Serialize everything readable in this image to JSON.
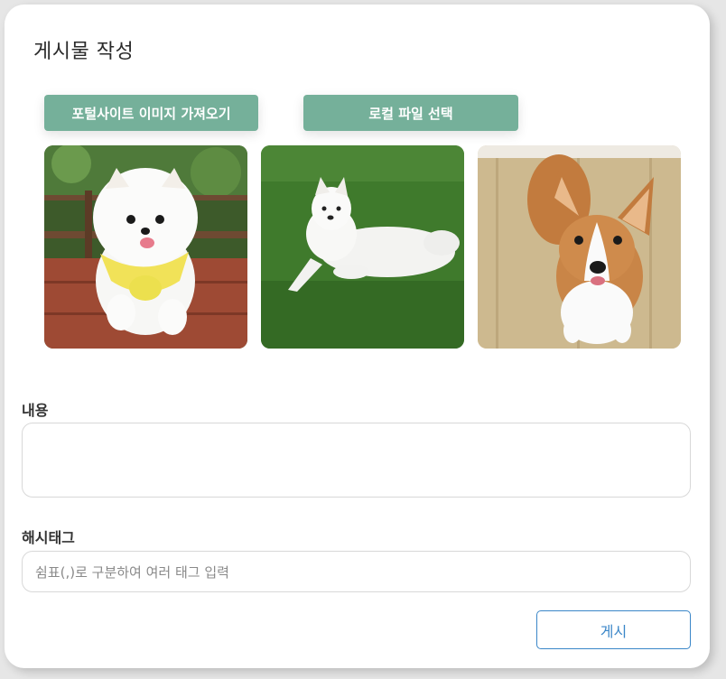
{
  "modal": {
    "title": "게시물 작성",
    "portal_button_label": "포털사이트 이미지 가져오기",
    "local_button_label": "로컬 파일 선택",
    "content_label": "내용",
    "content_value": "",
    "hashtag_label": "해시태그",
    "hashtag_placeholder": "쉼표(,)로 구분하여 여러 태그 입력",
    "post_button_label": "게시"
  },
  "images": [
    {
      "name": "pomeranian-photo"
    },
    {
      "name": "samoyed-photo"
    },
    {
      "name": "corgi-photo"
    }
  ],
  "colors": {
    "accent_green": "#75b09a",
    "post_blue": "#3a86c8"
  }
}
